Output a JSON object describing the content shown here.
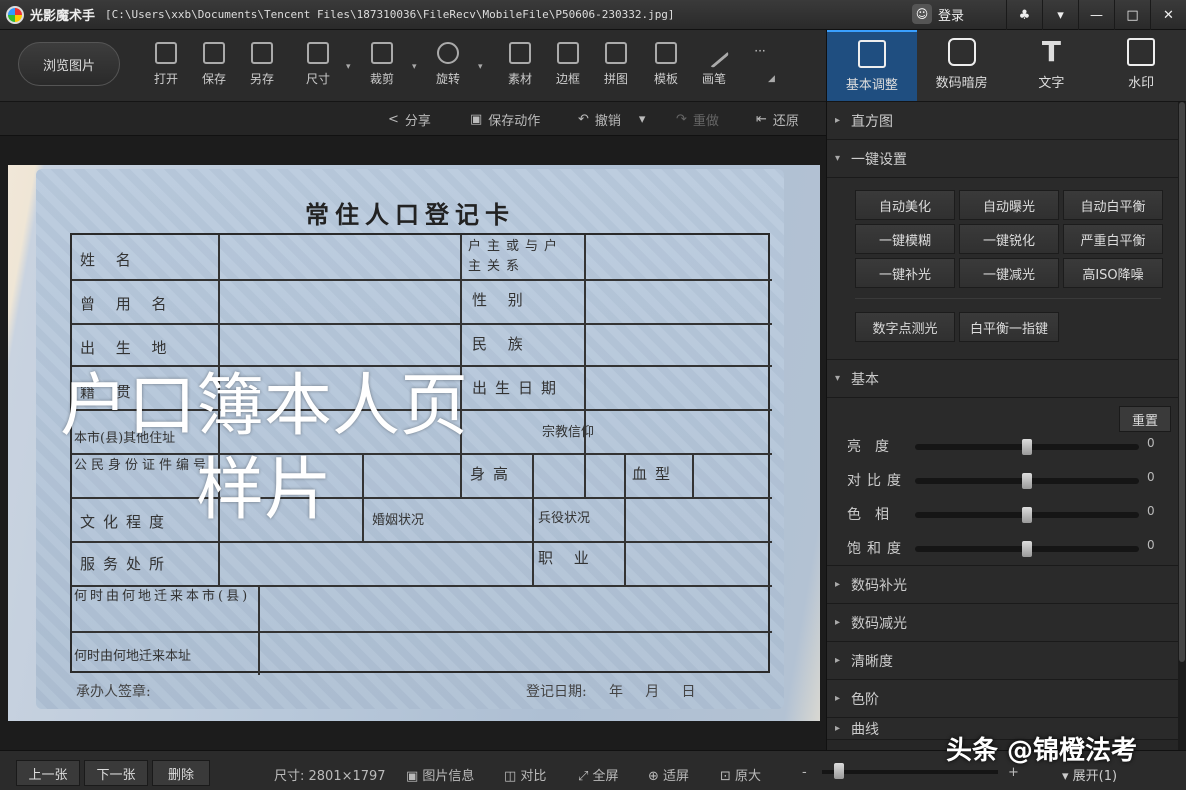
{
  "titlebar": {
    "app_name": "光影魔术手",
    "file_path": "[C:\\Users\\xxb\\Documents\\Tencent Files\\187310036\\FileRecv\\MobileFile\\P50606-230332.jpg]",
    "login_label": "登录"
  },
  "toolbar": {
    "browse_label": "浏览图片",
    "open": "打开",
    "save": "保存",
    "save_as": "另存",
    "size": "尺寸",
    "crop": "裁剪",
    "rotate": "旋转",
    "material": "素材",
    "border": "边框",
    "collage": "拼图",
    "template": "模板",
    "brush": "画笔",
    "more": "···"
  },
  "actionbar": {
    "share": "分享",
    "save_action": "保存动作",
    "undo": "撤销",
    "redo": "重做",
    "restore": "还原"
  },
  "photo": {
    "card_title": "常住人口登记卡",
    "watermark_line1": "户口簿本人页",
    "watermark_line2": "样片",
    "fields": {
      "name": "姓        名",
      "householder_relation": "户主或与户主关系",
      "former_name": "曾  用  名",
      "gender": "性    别",
      "birthplace": "出  生  地",
      "ethnicity": "民    族",
      "native_place": "籍    贯",
      "birth_date": "出生日期",
      "address": "本市(县)其他住址",
      "religion": "宗教信仰",
      "id_number": "公民身份证件编号",
      "height": "身高",
      "blood_type": "血型",
      "education": "文化程度",
      "marital_status": "婚姻状况",
      "military_status": "兵役状况",
      "workplace": "服务处所",
      "occupation": "职    业",
      "moved_in_city": "何时由何地迁来本市(县)",
      "moved_in_address": "何时由何地迁来本址"
    },
    "footer_signature": "承办人签章:",
    "footer_date": "登记日期:     年     月     日"
  },
  "rpanel": {
    "tabs": [
      "基本调整",
      "数码暗房",
      "文字",
      "水印"
    ],
    "histogram": "直方图",
    "quick_settings": "一键设置",
    "quick_buttons": [
      "自动美化",
      "自动曝光",
      "自动白平衡",
      "一键模糊",
      "一键锐化",
      "严重白平衡",
      "一键补光",
      "一键减光",
      "高ISO降噪"
    ],
    "quick_buttons_2": [
      "数字点测光",
      "白平衡一指键"
    ],
    "basic": "基本",
    "reset": "重置",
    "sliders": [
      {
        "label": "亮度",
        "value": "0",
        "level": 0.5
      },
      {
        "label": "对比度",
        "value": "0",
        "level": 0.5
      },
      {
        "label": "色相",
        "value": "0",
        "level": 0.5
      },
      {
        "label": "饱和度",
        "value": "0",
        "level": 0.5
      }
    ],
    "sections": [
      "数码补光",
      "数码减光",
      "清晰度",
      "色阶",
      "曲线"
    ]
  },
  "bottombar": {
    "prev": "上一张",
    "next": "下一张",
    "delete": "删除",
    "dimensions": "尺寸: 2801×1797",
    "image_info": "图片信息",
    "compare": "对比",
    "fullscreen": "全屏",
    "fit": "适屏",
    "actual": "原大",
    "expand": "展开(1)"
  },
  "overlay_brand": "头条 @锦橙法考"
}
